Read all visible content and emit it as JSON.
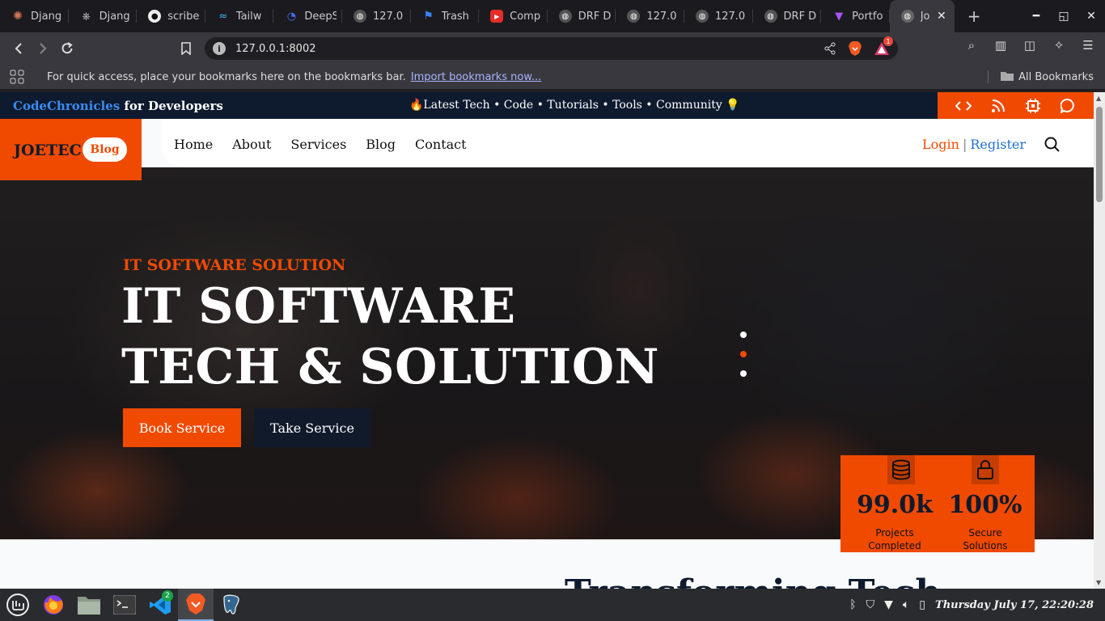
{
  "browser": {
    "tabs": [
      {
        "label": "Djang",
        "icon": "claude-icon"
      },
      {
        "label": "Djang",
        "icon": "openai-icon"
      },
      {
        "label": "scribe",
        "icon": "github-icon"
      },
      {
        "label": "Tailw",
        "icon": "tailwind-icon"
      },
      {
        "label": "DeepS",
        "icon": "deepseek-icon"
      },
      {
        "label": "127.0",
        "icon": "globe-icon"
      },
      {
        "label": "Trash",
        "icon": "flag-icon"
      },
      {
        "label": "Comp",
        "icon": "youtube-icon"
      },
      {
        "label": "DRF D",
        "icon": "globe-icon"
      },
      {
        "label": "127.0",
        "icon": "globe-icon"
      },
      {
        "label": "127.0",
        "icon": "globe-icon"
      },
      {
        "label": "DRF D",
        "icon": "globe-icon"
      },
      {
        "label": "Portfo",
        "icon": "vite-icon"
      }
    ],
    "active_tab": {
      "label": "Jo",
      "icon": "globe-icon"
    },
    "url": "127.0.0.1:8002",
    "notification_count": "1",
    "bookmarks_message": "For quick access, place your bookmarks here on the bookmarks bar.",
    "import_link": "Import bookmarks now...",
    "all_bookmarks": "All Bookmarks"
  },
  "site": {
    "topbar": {
      "brand_highlight": "CodeChronicles",
      "brand_rest": " for Developers",
      "tagline": "🔥Latest Tech • Code • Tutorials • Tools • Community 💡"
    },
    "logo": {
      "name": "JOETEC",
      "pill": "Blog"
    },
    "nav": {
      "links": [
        "Home",
        "About",
        "Services",
        "Blog",
        "Contact"
      ],
      "login": "Login",
      "separator": "|",
      "register": "Register"
    },
    "hero": {
      "kicker": "IT SOFTWARE SOLUTION",
      "title_line1": "IT SOFTWARE",
      "title_line2": "TECH & SOLUTION",
      "book_button": "Book Service",
      "take_button": "Take Service",
      "active_slide": 2,
      "slide_count": 3
    },
    "stats": [
      {
        "value": "99.0k",
        "label_line1": "Projects",
        "label_line2": "Completed",
        "icon": "database-icon"
      },
      {
        "value": "100%",
        "label_line1": "Secure",
        "label_line2": "Solutions",
        "icon": "lock-icon"
      }
    ],
    "section_title": "Transforming Tech"
  },
  "taskbar": {
    "apps": [
      "mint-menu-icon",
      "firefox-icon",
      "files-icon",
      "terminal-icon",
      "vscode-icon",
      "brave-icon",
      "postgres-icon"
    ],
    "vscode_badge": "2",
    "clock": "Thursday July 17, 22:20:28"
  },
  "colors": {
    "accent": "#f04a00",
    "navy": "#0e1a2e",
    "link_blue": "#1f6fd6"
  }
}
